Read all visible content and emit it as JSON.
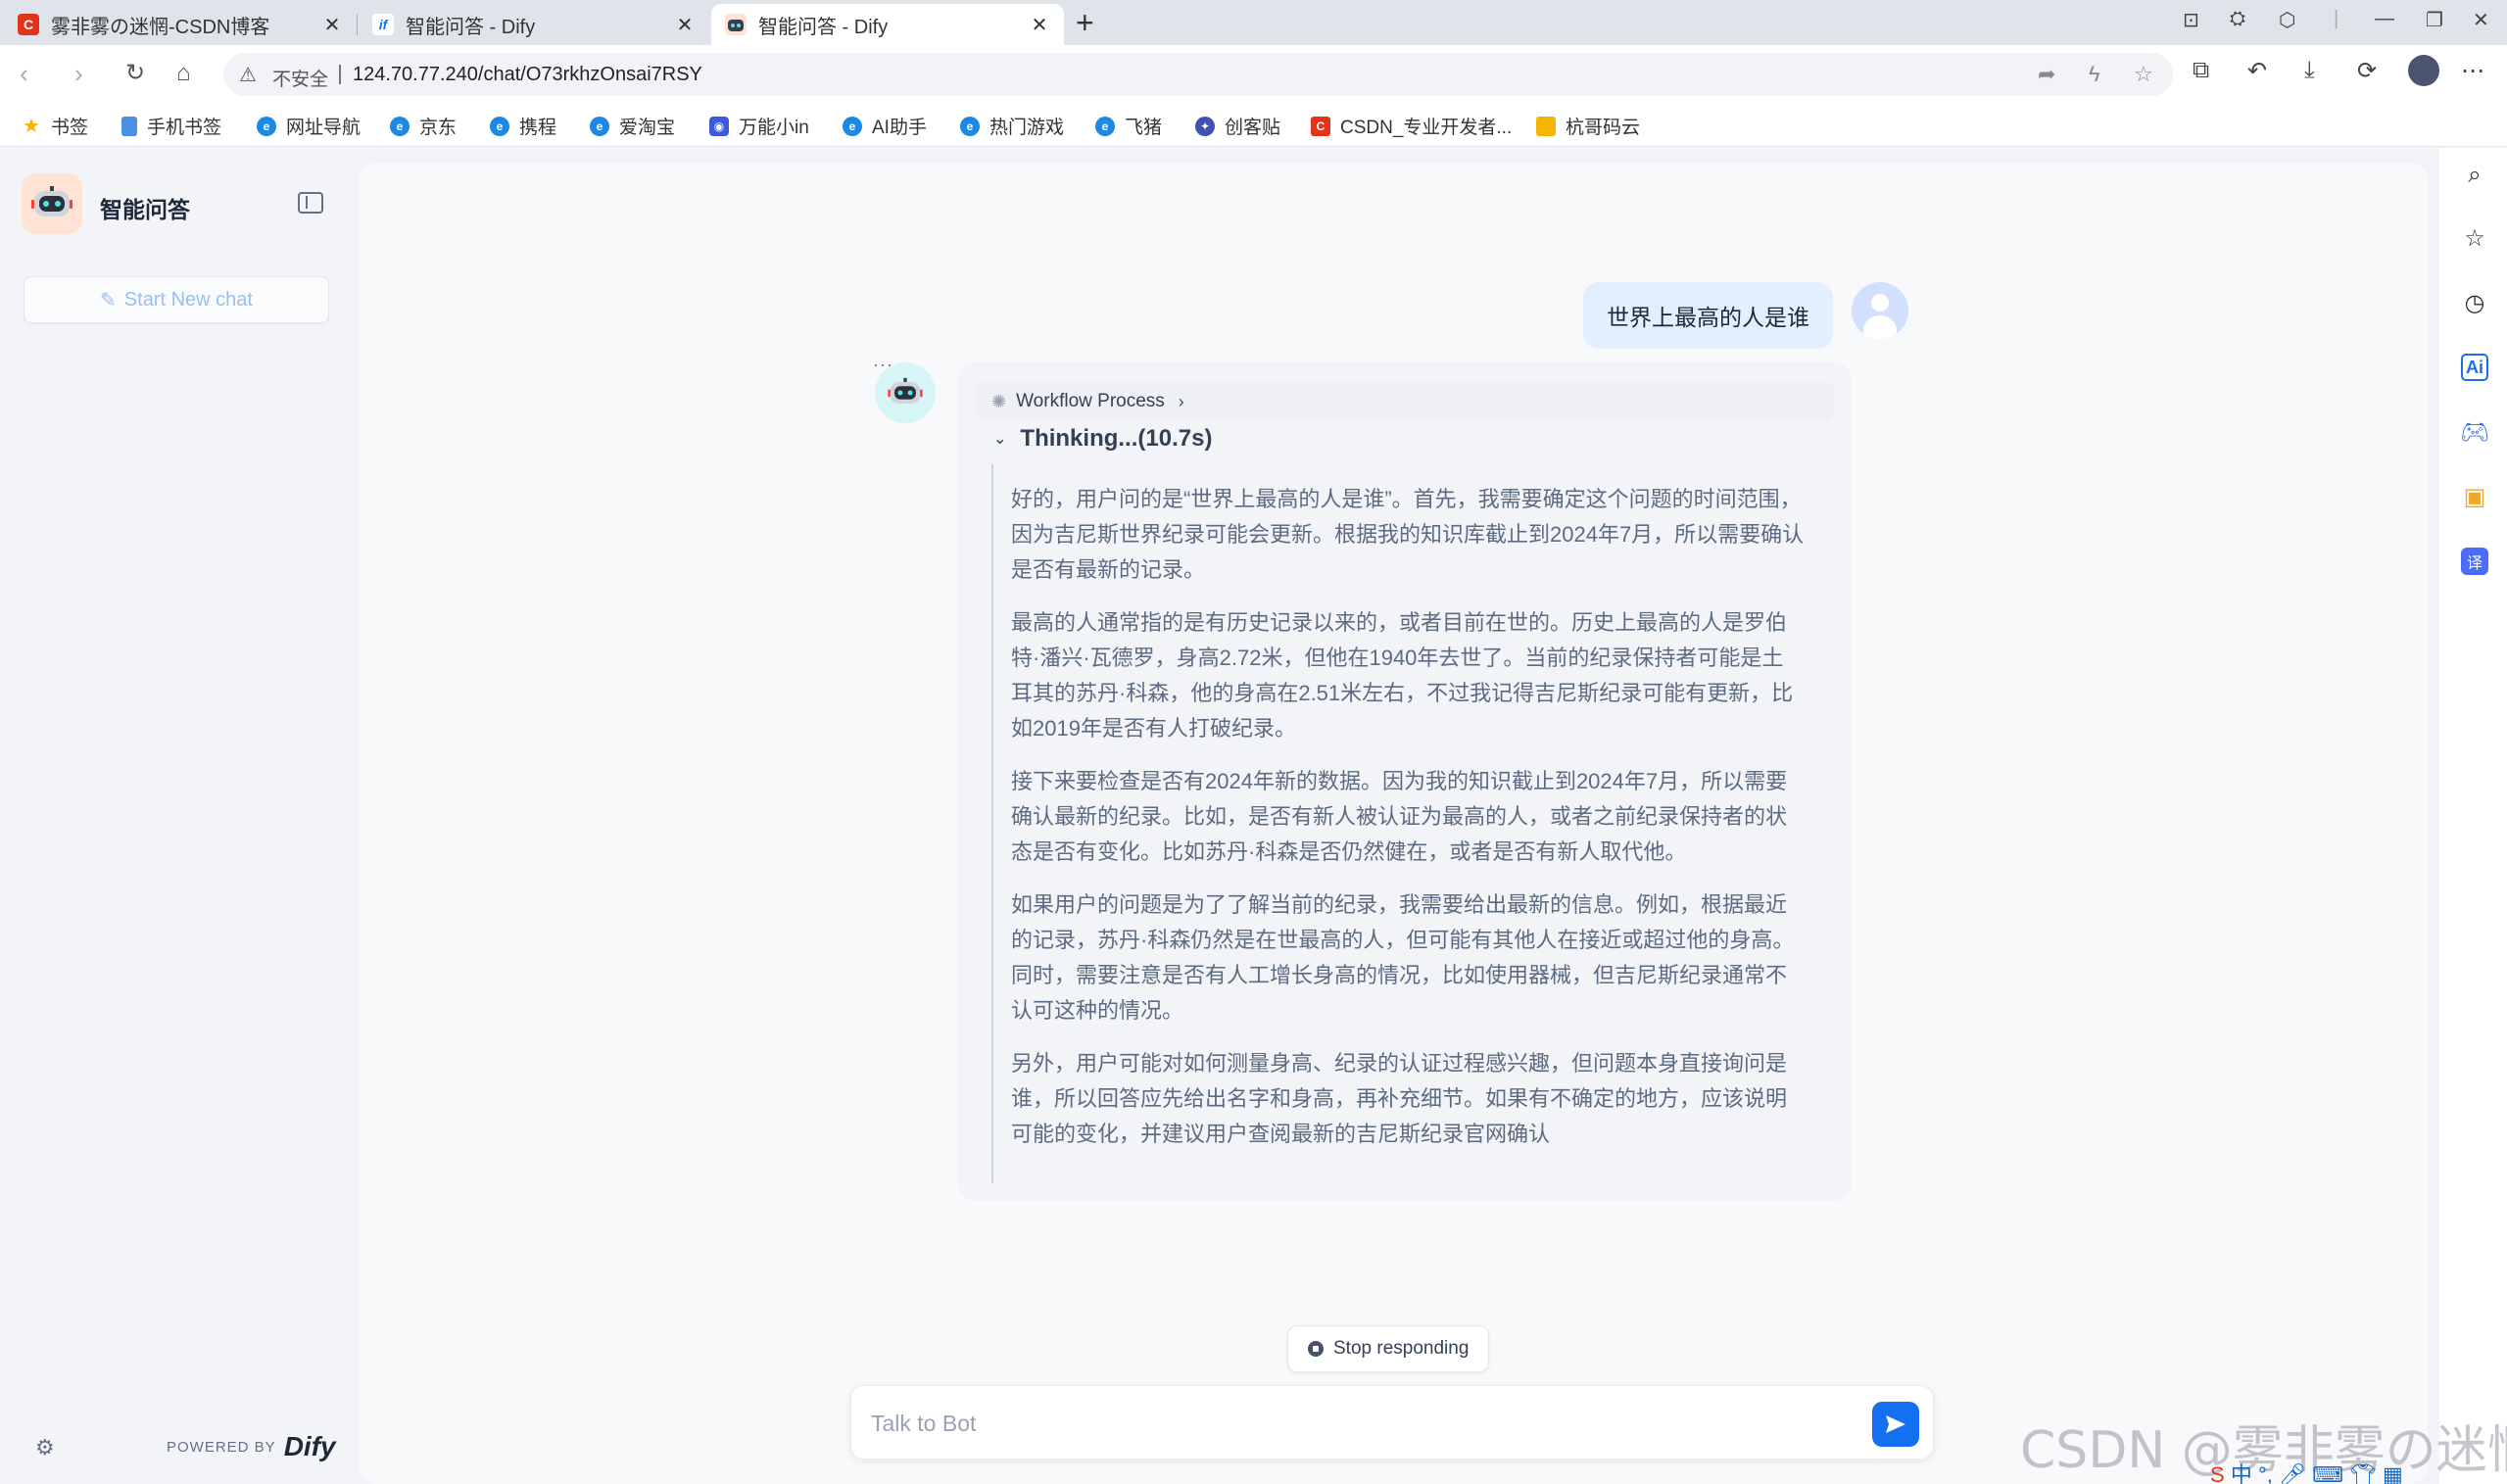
{
  "browser": {
    "tabs": [
      {
        "title": "雾非雾の迷惘-CSDN博客",
        "icon": "csdn-icon",
        "active": false
      },
      {
        "title": "智能问答 - Dify",
        "icon": "dify-icon",
        "active": false
      },
      {
        "title": "智能问答 - Dify",
        "icon": "robot-icon",
        "active": true
      }
    ],
    "address": {
      "security_label": "不安全",
      "url": "124.70.77.240/chat/O73rkhzOnsai7RSY"
    },
    "bookmarks": [
      "书签",
      "手机书签",
      "网址导航",
      "京东",
      "携程",
      "爱淘宝",
      "万能小in",
      "AI助手",
      "热门游戏",
      "飞猪",
      "创客贴",
      "CSDN_专业开发者...",
      "杭哥码云"
    ]
  },
  "sidebar": {
    "app_name": "智能问答",
    "new_chat_label": "Start New chat",
    "powered_by": "POWERED BY",
    "brand": "Dify"
  },
  "chat": {
    "user_message": "世界上最高的人是谁",
    "workflow_label": "Workflow Process",
    "thinking_label": "Thinking...(10.7s)",
    "thinking_paragraphs": [
      "好的，用户问的是“世界上最高的人是谁”。首先，我需要确定这个问题的时间范围，因为吉尼斯世界纪录可能会更新。根据我的知识库截止到2024年7月，所以需要确认是否有最新的记录。",
      "最高的人通常指的是有历史记录以来的，或者目前在世的。历史上最高的人是罗伯特·潘兴·瓦德罗，身高2.72米，但他在1940年去世了。当前的纪录保持者可能是土耳其的苏丹·科森，他的身高在2.51米左右，不过我记得吉尼斯纪录可能有更新，比如2019年是否有人打破纪录。",
      "接下来要检查是否有2024年新的数据。因为我的知识截止到2024年7月，所以需要确认最新的纪录。比如，是否有新人被认证为最高的人，或者之前纪录保持者的状态是否有变化。比如苏丹·科森是否仍然健在，或者是否有新人取代他。",
      "如果用户的问题是为了了解当前的纪录，我需要给出最新的信息。例如，根据最近的记录，苏丹·科森仍然是在世最高的人，但可能有其他人在接近或超过他的身高。同时，需要注意是否有人工增长身高的情况，比如使用器械，但吉尼斯纪录通常不认可这种的情况。",
      "另外，用户可能对如何测量身高、纪录的认证过程感兴趣，但问题本身直接询问是谁，所以回答应先给出名字和身高，再补充细节。如果有不确定的地方，应该说明可能的变化，并建议用户查阅最新的吉尼斯纪录官网确认"
    ],
    "stop_label": "Stop responding",
    "input_placeholder": "Talk to Bot"
  },
  "watermark": "CSDN @雾非雾の迷惘",
  "colors": {
    "accent": "#1570ef",
    "user_bubble": "#e1effe",
    "bot_card": "#f2f4f7"
  }
}
